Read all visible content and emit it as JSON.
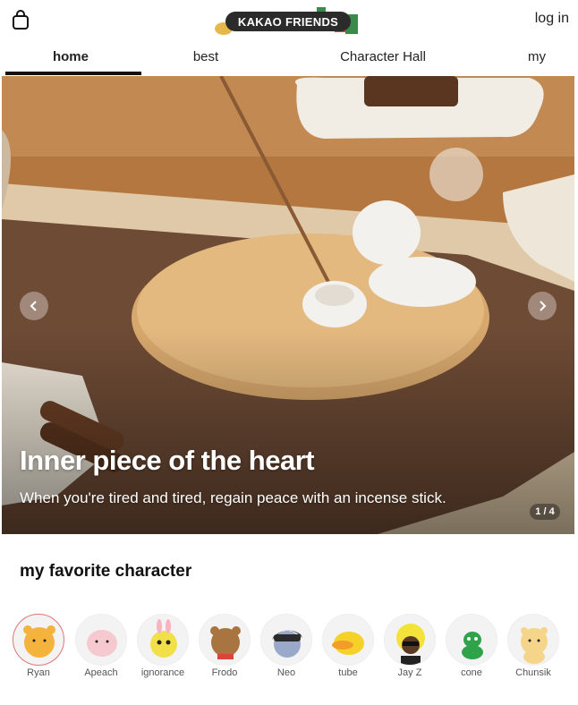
{
  "header": {
    "logo_text": "KAKAO FRIENDS",
    "login_label": "log in",
    "bag_icon": "shopping-bag-icon"
  },
  "tabs": [
    {
      "label": "home",
      "active": true
    },
    {
      "label": "best",
      "active": false
    },
    {
      "label": "Character Hall",
      "active": false
    },
    {
      "label": "my",
      "active": false
    }
  ],
  "banner": {
    "title": "Inner piece of the heart",
    "subtitle": "When you're tired and tired, regain peace with an incense stick.",
    "pager": "1 / 4",
    "prev_icon": "chevron-left-icon",
    "next_icon": "chevron-right-icon"
  },
  "favorites": {
    "title": "my favorite character",
    "characters": [
      {
        "name": "Ryan",
        "color": "#f3b33d",
        "selected": true
      },
      {
        "name": "Apeach",
        "color": "#f6c8cf",
        "selected": false
      },
      {
        "name": "ignorance",
        "color": "#f2e04a",
        "selected": false
      },
      {
        "name": "Frodo",
        "color": "#a8743f",
        "selected": false
      },
      {
        "name": "Neo",
        "color": "#3a3a3a",
        "selected": false
      },
      {
        "name": "tube",
        "color": "#f5d12a",
        "selected": false
      },
      {
        "name": "Jay Z",
        "color": "#f3e23a",
        "selected": false
      },
      {
        "name": "cone",
        "color": "#2ea34a",
        "selected": false
      },
      {
        "name": "Chunsik",
        "color": "#f5d58a",
        "selected": false
      }
    ]
  }
}
